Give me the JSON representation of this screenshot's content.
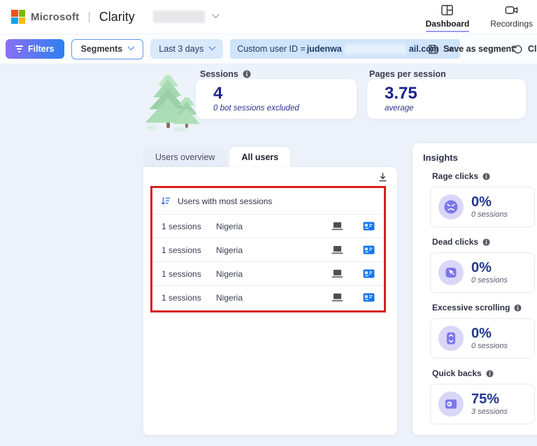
{
  "topbar": {
    "microsoft": "Microsoft",
    "product": "Clarity",
    "nav": {
      "dashboard": "Dashboard",
      "recordings": "Recordings"
    }
  },
  "filter_bar": {
    "filters": "Filters",
    "segments": "Segments",
    "date_range": "Last 3 days",
    "chip": {
      "prefix": "Custom user ID = ",
      "user_start": "judenwa",
      "user_end": "ail.com",
      "close_glyph": "×"
    },
    "save_as_segment": "Save as segment",
    "clear": "Cle"
  },
  "metrics": {
    "sessions": {
      "label": "Sessions",
      "value": "4",
      "subtext": "0 bot sessions excluded"
    },
    "pages_per_session": {
      "label": "Pages per session",
      "value": "3.75",
      "subtext": "average"
    }
  },
  "tabs": {
    "users_overview": "Users overview",
    "all_users": "All users"
  },
  "table": {
    "header": "Users with most sessions",
    "rows": [
      {
        "sessions": "1 sessions",
        "country": "Nigeria",
        "device_icon": "laptop-icon",
        "user_icon": "id-card-icon"
      },
      {
        "sessions": "1 sessions",
        "country": "Nigeria",
        "device_icon": "laptop-icon",
        "user_icon": "id-card-icon"
      },
      {
        "sessions": "1 sessions",
        "country": "Nigeria",
        "device_icon": "laptop-icon",
        "user_icon": "id-card-icon"
      },
      {
        "sessions": "1 sessions",
        "country": "Nigeria",
        "device_icon": "laptop-icon",
        "user_icon": "id-card-icon"
      }
    ]
  },
  "insights": {
    "title": "Insights",
    "items": [
      {
        "label": "Rage clicks",
        "value": "0%",
        "sessions": "0 sessions",
        "icon": "angry-face-icon"
      },
      {
        "label": "Dead clicks",
        "value": "0%",
        "sessions": "0 sessions",
        "icon": "dead-click-cursor-icon"
      },
      {
        "label": "Excessive scrolling",
        "value": "0%",
        "sessions": "0 sessions",
        "icon": "phone-scroll-icon"
      },
      {
        "label": "Quick backs",
        "value": "75%",
        "sessions": "3 sessions",
        "icon": "quick-back-icon"
      }
    ]
  },
  "colors": {
    "accent_blue": "#2e7ff0",
    "filters_gradient_start": "#8a70f2",
    "filters_gradient_end": "#2e7ff0",
    "value_navy": "#1b2290",
    "highlight_red": "#d81f1f",
    "lavender_icon_bg": "#d9d6f8",
    "insight_purple": "#7c76e9",
    "chip_bg": "#cfe4fa",
    "page_bg": "#edf2fa",
    "dashboard_underline": "#9a9df3"
  }
}
